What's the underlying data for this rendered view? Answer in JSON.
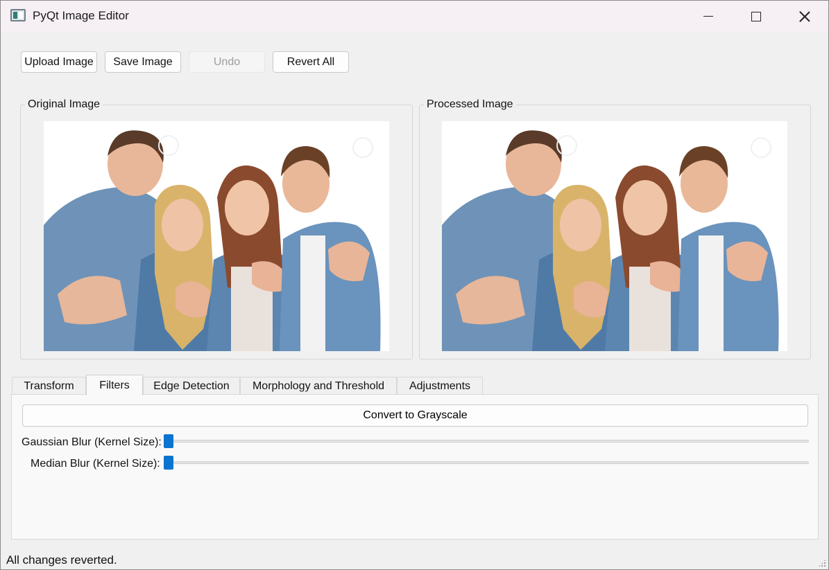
{
  "window": {
    "title": "PyQt Image Editor",
    "icon": "app-image-icon",
    "controls": [
      "minimize-icon",
      "maximize-icon",
      "close-icon"
    ]
  },
  "toolbar": {
    "upload_label": "Upload Image",
    "save_label": "Save Image",
    "undo_label": "Undo",
    "undo_enabled": false,
    "revert_label": "Revert All"
  },
  "panels": {
    "original_title": "Original Image",
    "processed_title": "Processed Image"
  },
  "tabs": [
    {
      "label": "Transform",
      "active": false
    },
    {
      "label": "Filters",
      "active": true
    },
    {
      "label": "Edge Detection",
      "active": false
    },
    {
      "label": "Morphology and Threshold",
      "active": false
    },
    {
      "label": "Adjustments",
      "active": false
    }
  ],
  "filters": {
    "grayscale_label": "Convert to Grayscale",
    "gaussian_label": "Gaussian Blur (Kernel Size):",
    "gaussian_value": 0,
    "median_label": "Median Blur (Kernel Size):",
    "median_value": 0
  },
  "status": {
    "message": "All changes reverted."
  },
  "colors": {
    "accent": "#0a74d0",
    "window_bg": "#f0f0f0",
    "titlebar_bg": "#f6eff4"
  }
}
